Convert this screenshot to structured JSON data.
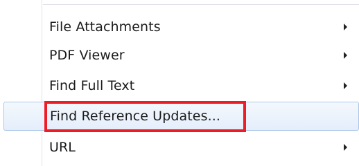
{
  "menu": {
    "items": [
      {
        "label": "File Attachments",
        "has_submenu": true,
        "icon": "submenu-arrow-icon"
      },
      {
        "label": "PDF Viewer",
        "has_submenu": true,
        "icon": "submenu-arrow-icon"
      },
      {
        "label": "Find Full Text",
        "has_submenu": true,
        "icon": "submenu-arrow-icon"
      },
      {
        "label": "Find Reference Updates...",
        "has_submenu": false,
        "selected": true,
        "highlighted": true,
        "highlight_color": "#ee1c25"
      },
      {
        "label": "URL",
        "has_submenu": true,
        "icon": "submenu-arrow-icon"
      }
    ],
    "selected_background": "#e4eefb",
    "selected_border": "#aac6e9"
  }
}
